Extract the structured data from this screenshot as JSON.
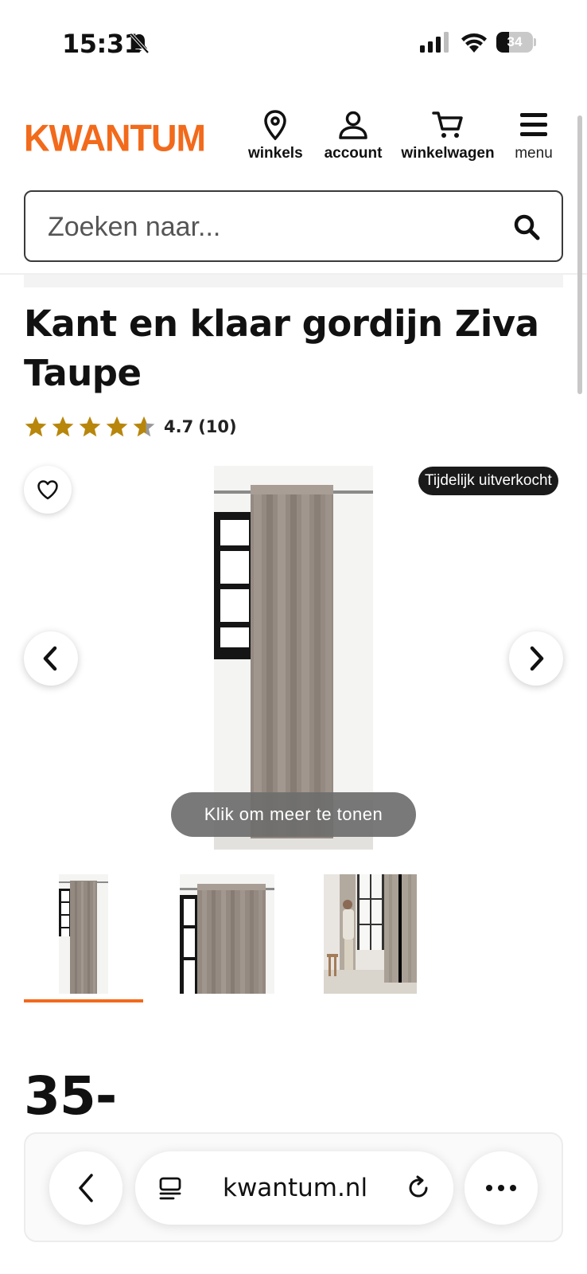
{
  "status_bar": {
    "time": "15:31",
    "battery": "34",
    "battery_level": 0.34
  },
  "header": {
    "logo": "KWANTUM",
    "nav": [
      {
        "label": "winkels",
        "icon": "location-pin-icon"
      },
      {
        "label": "account",
        "icon": "user-icon"
      },
      {
        "label": "winkelwagen",
        "icon": "cart-icon"
      },
      {
        "label": "menu",
        "icon": "hamburger-menu-icon"
      }
    ]
  },
  "search": {
    "placeholder": "Zoeken naar...",
    "value": ""
  },
  "product": {
    "title": "Kant en klaar gordijn Ziva Taupe",
    "rating": "4.7",
    "rating_count": "(10)",
    "rating_value": 4.7,
    "rating_max": 5,
    "badge": "Tijdelijk uitverkocht",
    "more_button": "Klik om meer te tonen",
    "price": "35-",
    "thumbnails": [
      "curtain-front-thumbnail",
      "curtain-closeup-thumbnail",
      "curtain-lifestyle-thumbnail"
    ],
    "selected_thumbnail": 0
  },
  "browser": {
    "url": "kwantum.nl"
  },
  "colors": {
    "brand": "#f26a1b",
    "star": "#b8860b",
    "badge_bg": "#1a1a1a"
  }
}
